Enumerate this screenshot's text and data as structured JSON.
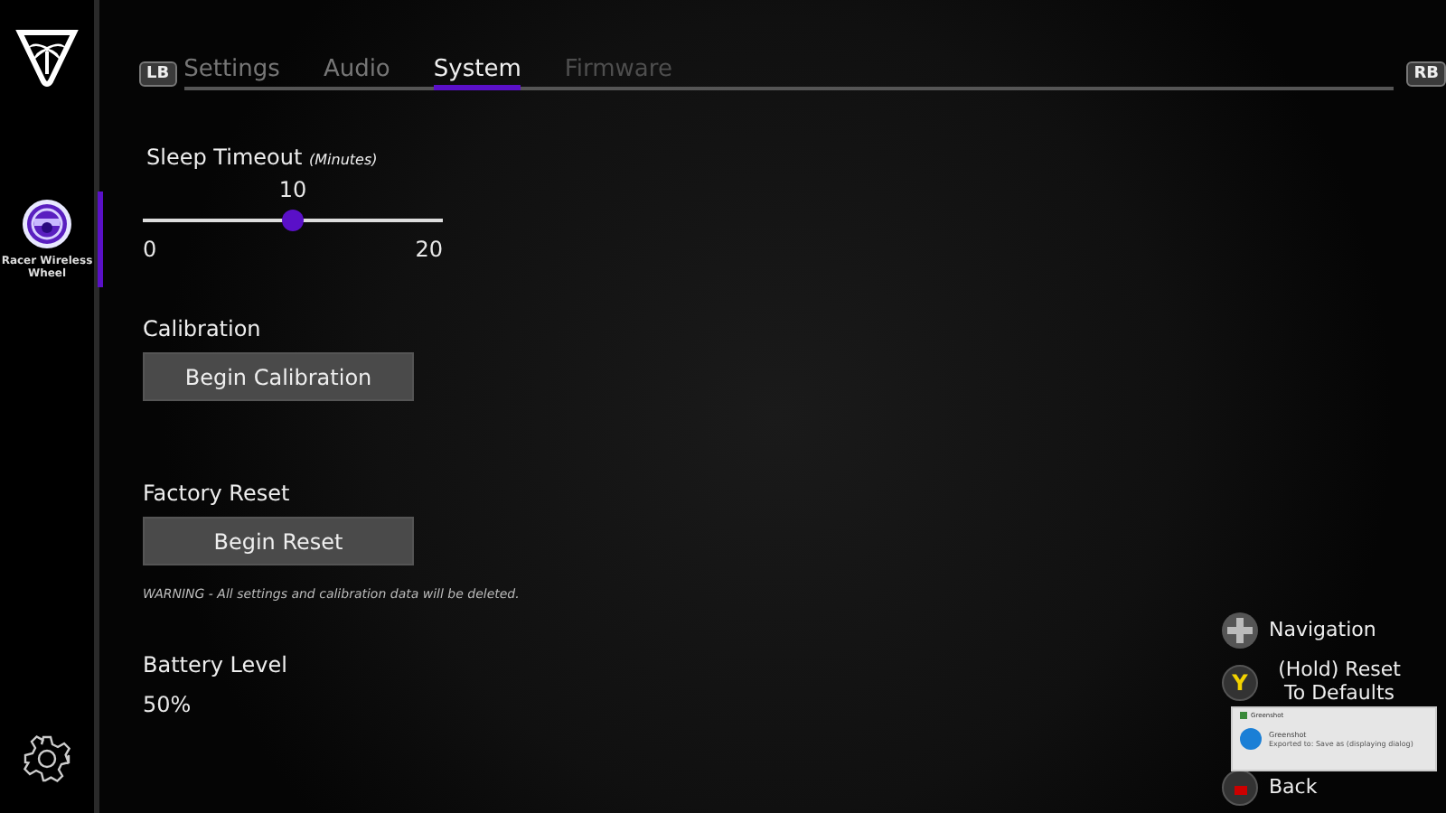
{
  "sidebar": {
    "devices": [
      {
        "name": "Racer Wireless Wheel",
        "selected": true
      }
    ]
  },
  "tabs": {
    "left_bumper": "LB",
    "right_bumper": "RB",
    "items": [
      {
        "label": "Settings",
        "selected": false,
        "disabled": false
      },
      {
        "label": "Audio",
        "selected": false,
        "disabled": false
      },
      {
        "label": "System",
        "selected": true,
        "disabled": false
      },
      {
        "label": "Firmware",
        "selected": false,
        "disabled": true
      }
    ]
  },
  "sleep_timeout": {
    "label": "Sleep Timeout",
    "unit": "(Minutes)",
    "value": "10",
    "min": "0",
    "max": "20",
    "level": 0.5
  },
  "calibration": {
    "heading": "Calibration",
    "button": "Begin Calibration"
  },
  "factory_reset": {
    "heading": "Factory Reset",
    "button": "Begin Reset",
    "warning": "WARNING - All settings and calibration data will be deleted."
  },
  "battery": {
    "heading": "Battery Level",
    "value": "50%"
  },
  "legend": [
    {
      "kind": "dpad",
      "label": "Navigation"
    },
    {
      "kind": "y",
      "glyph": "Y",
      "label": "(Hold) Reset To Defaults"
    },
    {
      "kind": "b",
      "label": "Back"
    }
  ],
  "notification": {
    "app": "Greenshot",
    "title": "Greenshot",
    "message": "Exported to: Save as (displaying dialog)"
  }
}
